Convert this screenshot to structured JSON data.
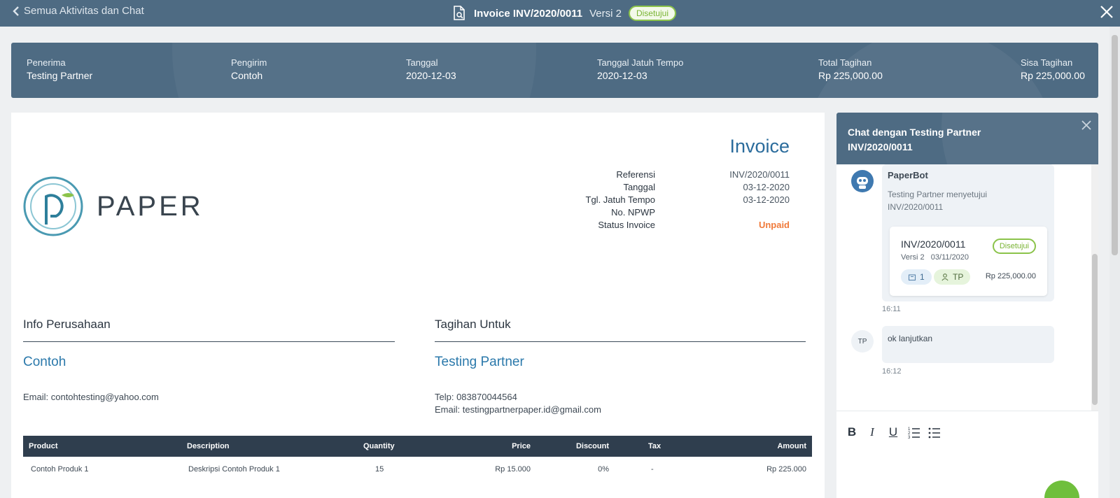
{
  "topbar": {
    "back_label": "Semua Aktivitas dan Chat",
    "title": "Invoice INV/2020/0011",
    "version": "Versi 2",
    "status": "Disetujui"
  },
  "summary": [
    {
      "label": "Penerima",
      "value": "Testing Partner"
    },
    {
      "label": "Pengirim",
      "value": "Contoh"
    },
    {
      "label": "Tanggal",
      "value": "2020-12-03"
    },
    {
      "label": "Tanggal Jatuh Tempo",
      "value": "2020-12-03"
    },
    {
      "label": "Total Tagihan",
      "value": "Rp 225,000.00"
    },
    {
      "label": "Sisa Tagihan",
      "value": "Rp 225,000.00"
    }
  ],
  "invoice": {
    "heading": "Invoice",
    "logo_text": "PAPER",
    "meta_labels": [
      "Referensi",
      "Tanggal",
      "Tgl. Jatuh Tempo",
      "No. NPWP",
      "Status Invoice"
    ],
    "meta_values": [
      "INV/2020/0011",
      "03-12-2020",
      "03-12-2020",
      "",
      "Unpaid"
    ],
    "company_section_title": "Info Perusahaan",
    "company_name": "Contoh",
    "company_email": "Email: contohtesting@yahoo.com",
    "billto_section_title": "Tagihan Untuk",
    "billto_name": "Testing Partner",
    "billto_phone": "Telp: 083870044564",
    "billto_email": "Email: testingpartnerpaper.id@gmail.com",
    "table": {
      "headers": [
        "Product",
        "Description",
        "Quantity",
        "Price",
        "Discount",
        "Tax",
        "Amount"
      ],
      "rows": [
        [
          "Contoh Produk 1",
          "Deskripsi Contoh Produk 1",
          "15",
          "Rp 15.000",
          "0%",
          "-",
          "Rp 225.000"
        ]
      ]
    }
  },
  "chat": {
    "title_line1": "Chat dengan Testing Partner",
    "title_line2": "INV/2020/0011",
    "messages": [
      {
        "sender": "PaperBot",
        "text": "Testing Partner menyetujui INV/2020/0011",
        "time": "16:11",
        "card": {
          "id": "INV/2020/0011",
          "sub": "Versi 2   03/11/2020",
          "status": "Disetujui",
          "count": "1",
          "initials": "TP",
          "amount": "Rp 225,000.00"
        }
      },
      {
        "avatar": "TP",
        "text": "ok lanjutkan",
        "time": "16:12"
      }
    ],
    "toolbar": [
      "B",
      "I",
      "U",
      "ordered-list",
      "bullet-list"
    ]
  },
  "colors": {
    "header_bg": "#4e6b83",
    "accent_blue": "#2b79ab",
    "approved_green": "#8bc34a",
    "unpaid_orange": "#f07a3a",
    "table_header_bg": "#2f3e4e",
    "send_green": "#6fbf3c"
  }
}
